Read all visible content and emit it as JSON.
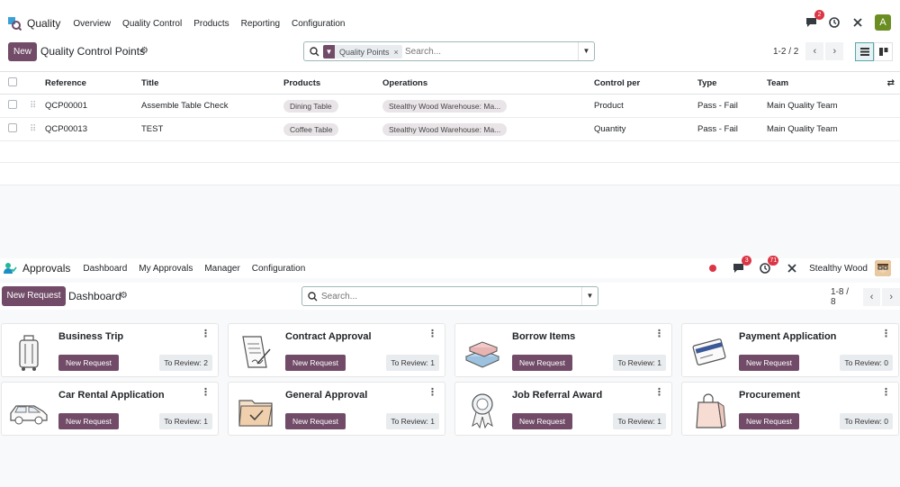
{
  "quality": {
    "app_name": "Quality",
    "menu": [
      "Overview",
      "Quality Control",
      "Products",
      "Reporting",
      "Configuration"
    ],
    "chat_badge": "2",
    "user_initial": "A",
    "new_label": "New",
    "page_title": "Quality Control Points",
    "search": {
      "facet": "Quality Points",
      "placeholder": "Search..."
    },
    "pager": "1-2 / 2",
    "columns": [
      "Reference",
      "Title",
      "Products",
      "Operations",
      "Control per",
      "Type",
      "Team"
    ],
    "rows": [
      {
        "reference": "QCP00001",
        "title": "Assemble Table Check",
        "product": "Dining Table",
        "operation": "Stealthy Wood Warehouse: Ma...",
        "control_per": "Product",
        "type": "Pass - Fail",
        "team": "Main Quality Team"
      },
      {
        "reference": "QCP00013",
        "title": "TEST",
        "product": "Coffee Table",
        "operation": "Stealthy Wood Warehouse: Ma...",
        "control_per": "Quantity",
        "type": "Pass - Fail",
        "team": "Main Quality Team"
      }
    ]
  },
  "approvals": {
    "app_name": "Approvals",
    "menu": [
      "Dashboard",
      "My Approvals",
      "Manager",
      "Configuration"
    ],
    "chat_badge": "3",
    "activity_badge": "71",
    "user_name": "Stealthy Wood",
    "new_request_label": "New Request",
    "page_title": "Dashboard",
    "search": {
      "placeholder": "Search..."
    },
    "pager": "1-8 / 8",
    "cards": [
      {
        "title": "Business Trip",
        "button": "New Request",
        "review": "To Review: 2",
        "icon": "luggage-icon"
      },
      {
        "title": "Contract Approval",
        "button": "New Request",
        "review": "To Review: 1",
        "icon": "contract-icon"
      },
      {
        "title": "Borrow Items",
        "button": "New Request",
        "review": "To Review: 1",
        "icon": "books-icon"
      },
      {
        "title": "Payment Application",
        "button": "New Request",
        "review": "To Review: 0",
        "icon": "card-payment-icon"
      },
      {
        "title": "Car Rental Application",
        "button": "New Request",
        "review": "To Review: 1",
        "icon": "car-icon"
      },
      {
        "title": "General Approval",
        "button": "New Request",
        "review": "To Review: 1",
        "icon": "folder-check-icon"
      },
      {
        "title": "Job Referral Award",
        "button": "New Request",
        "review": "To Review: 1",
        "icon": "award-badge-icon"
      },
      {
        "title": "Procurement",
        "button": "New Request",
        "review": "To Review: 0",
        "icon": "shopping-bag-icon"
      }
    ]
  },
  "colors": {
    "brand": "#714b67",
    "accent": "#017e84",
    "badge": "#dc3545"
  }
}
